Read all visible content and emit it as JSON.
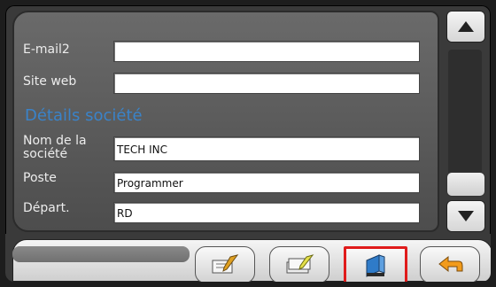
{
  "form": {
    "rows": [
      {
        "label": "E-mail2",
        "value": ""
      },
      {
        "label": "Site web",
        "value": ""
      },
      {
        "label": "Nom de la société",
        "value": "TECH INC"
      },
      {
        "label": "Poste",
        "value": "Programmer"
      },
      {
        "label": "Départ.",
        "value": "RD"
      }
    ],
    "section_title": "Détails société"
  },
  "scrollbar": {
    "up_icon": "triangle-up",
    "down_icon": "triangle-down"
  },
  "toolbar": {
    "buttons": [
      {
        "name": "edit",
        "icon": "edit-pencil-icon"
      },
      {
        "name": "edit-list",
        "icon": "edit-list-icon"
      },
      {
        "name": "book",
        "icon": "book-icon",
        "selected": true
      },
      {
        "name": "back",
        "icon": "back-arrow-icon"
      }
    ]
  }
}
